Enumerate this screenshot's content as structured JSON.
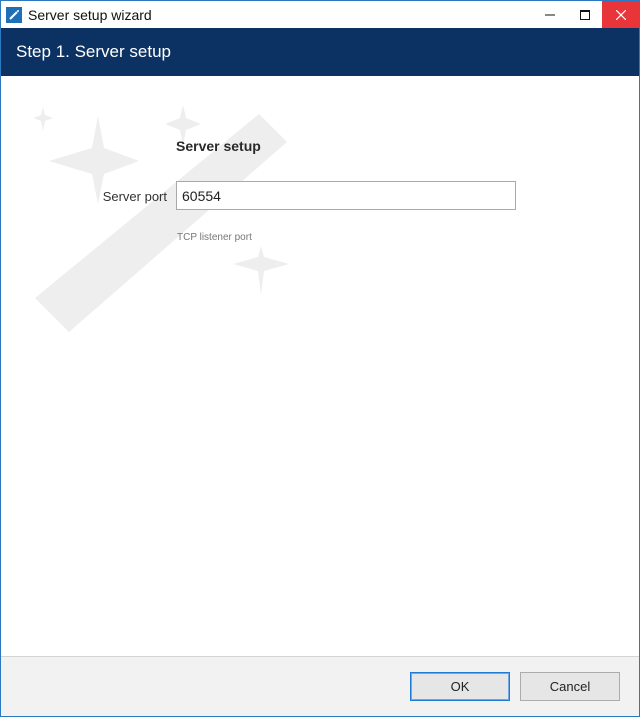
{
  "window": {
    "title": "Server setup wizard",
    "icon": "magic-wand-icon",
    "controls": {
      "minimize": "minimize-icon",
      "maximize": "maximize-icon",
      "close": "close-icon"
    }
  },
  "header": {
    "title": "Step 1. Server setup"
  },
  "form": {
    "section_title": "Server setup",
    "server_port": {
      "label": "Server port",
      "value": "60554",
      "hint": "TCP listener port"
    }
  },
  "footer": {
    "ok_label": "OK",
    "cancel_label": "Cancel"
  },
  "colors": {
    "header_band": "#0c3264",
    "close_button": "#e8353a",
    "window_border": "#2b79c2"
  }
}
